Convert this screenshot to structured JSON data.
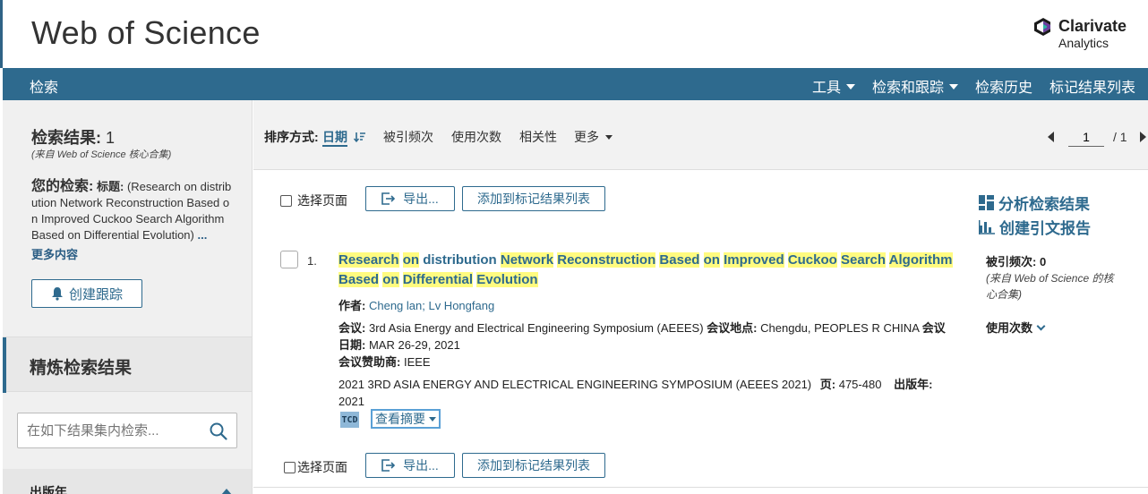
{
  "header": {
    "title": "Web of Science",
    "brand_name": "Clarivate",
    "brand_sub": "Analytics"
  },
  "nav": {
    "home": "检索",
    "items": [
      "工具",
      "检索和跟踪",
      "检索历史",
      "标记结果列表"
    ]
  },
  "sidebar": {
    "results_label": "检索结果:",
    "results_count": "1",
    "source_note": "(来自 Web of Science 核心合集)",
    "your_search_label": "您的检索:",
    "search_field": "标题:",
    "search_query": "(Research on distribution Network Reconstruction Based on Improved Cuckoo Search Algorithm Based on Differential Evolution)",
    "ellipsis": "...",
    "more_content": "更多内容",
    "create_alert": "创建跟踪",
    "refine_title": "精炼检索结果",
    "refine_placeholder": "在如下结果集内检索...",
    "facet_title": "出版年"
  },
  "sortbar": {
    "label": "排序方式:",
    "options": [
      "日期",
      "被引频次",
      "使用次数",
      "相关性",
      "更多"
    ],
    "page_current": "1",
    "page_total": "/ 1"
  },
  "toolbar": {
    "select_page": "选择页面",
    "export": "导出...",
    "add_marked": "添加到标记结果列表"
  },
  "analysis": {
    "analyze": "分析检索结果",
    "citation_report": "创建引文报告"
  },
  "record": {
    "number": "1.",
    "title_words": [
      {
        "t": "Research",
        "h": true
      },
      {
        "t": " ",
        "h": false
      },
      {
        "t": "on",
        "h": true
      },
      {
        "t": " distribution ",
        "h": false
      },
      {
        "t": "Network",
        "h": true
      },
      {
        "t": " ",
        "h": false
      },
      {
        "t": "Reconstruction",
        "h": true
      },
      {
        "t": " ",
        "h": false
      },
      {
        "t": "Based",
        "h": true
      },
      {
        "t": " ",
        "h": false
      },
      {
        "t": "on",
        "h": true
      },
      {
        "t": " ",
        "h": false
      },
      {
        "t": "Improved",
        "h": true
      },
      {
        "t": " ",
        "h": false
      },
      {
        "t": "Cuckoo",
        "h": true
      },
      {
        "t": " ",
        "h": false
      },
      {
        "t": "Search",
        "h": true
      },
      {
        "t": " ",
        "h": false
      },
      {
        "t": "Algorithm",
        "h": true
      },
      {
        "t": " ",
        "h": false
      },
      {
        "t": "Based",
        "h": true
      },
      {
        "t": " ",
        "h": false
      },
      {
        "t": "on",
        "h": true
      },
      {
        "t": " ",
        "h": false
      },
      {
        "t": "Differential",
        "h": true
      },
      {
        "t": " ",
        "h": false
      },
      {
        "t": "Evolution",
        "h": true
      }
    ],
    "authors_label": "作者:",
    "authors": "Cheng lan; Lv Hongfang",
    "conference_label": "会议:",
    "conference": "3rd Asia Energy and Electrical Engineering Symposium (AEEES)",
    "location_label": "会议地点:",
    "location": "Chengdu, PEOPLES R CHINA",
    "date_label": "会议日期:",
    "date": "MAR 26-29, 2021",
    "sponsor_label": "会议赞助商:",
    "sponsor": "IEEE",
    "source": "2021 3RD ASIA ENERGY AND ELECTRICAL ENGINEERING SYMPOSIUM (AEEES 2021)",
    "pages_label": "页:",
    "pages": "475-480",
    "year_label": "出版年:",
    "year": "2021",
    "tc_badge": "TCD",
    "abstract_button": "查看摘要",
    "times_cited_label": "被引频次:",
    "times_cited": "0",
    "cited_source": "(来自 Web of Science 的核心合集)",
    "usage_label": "使用次数"
  }
}
